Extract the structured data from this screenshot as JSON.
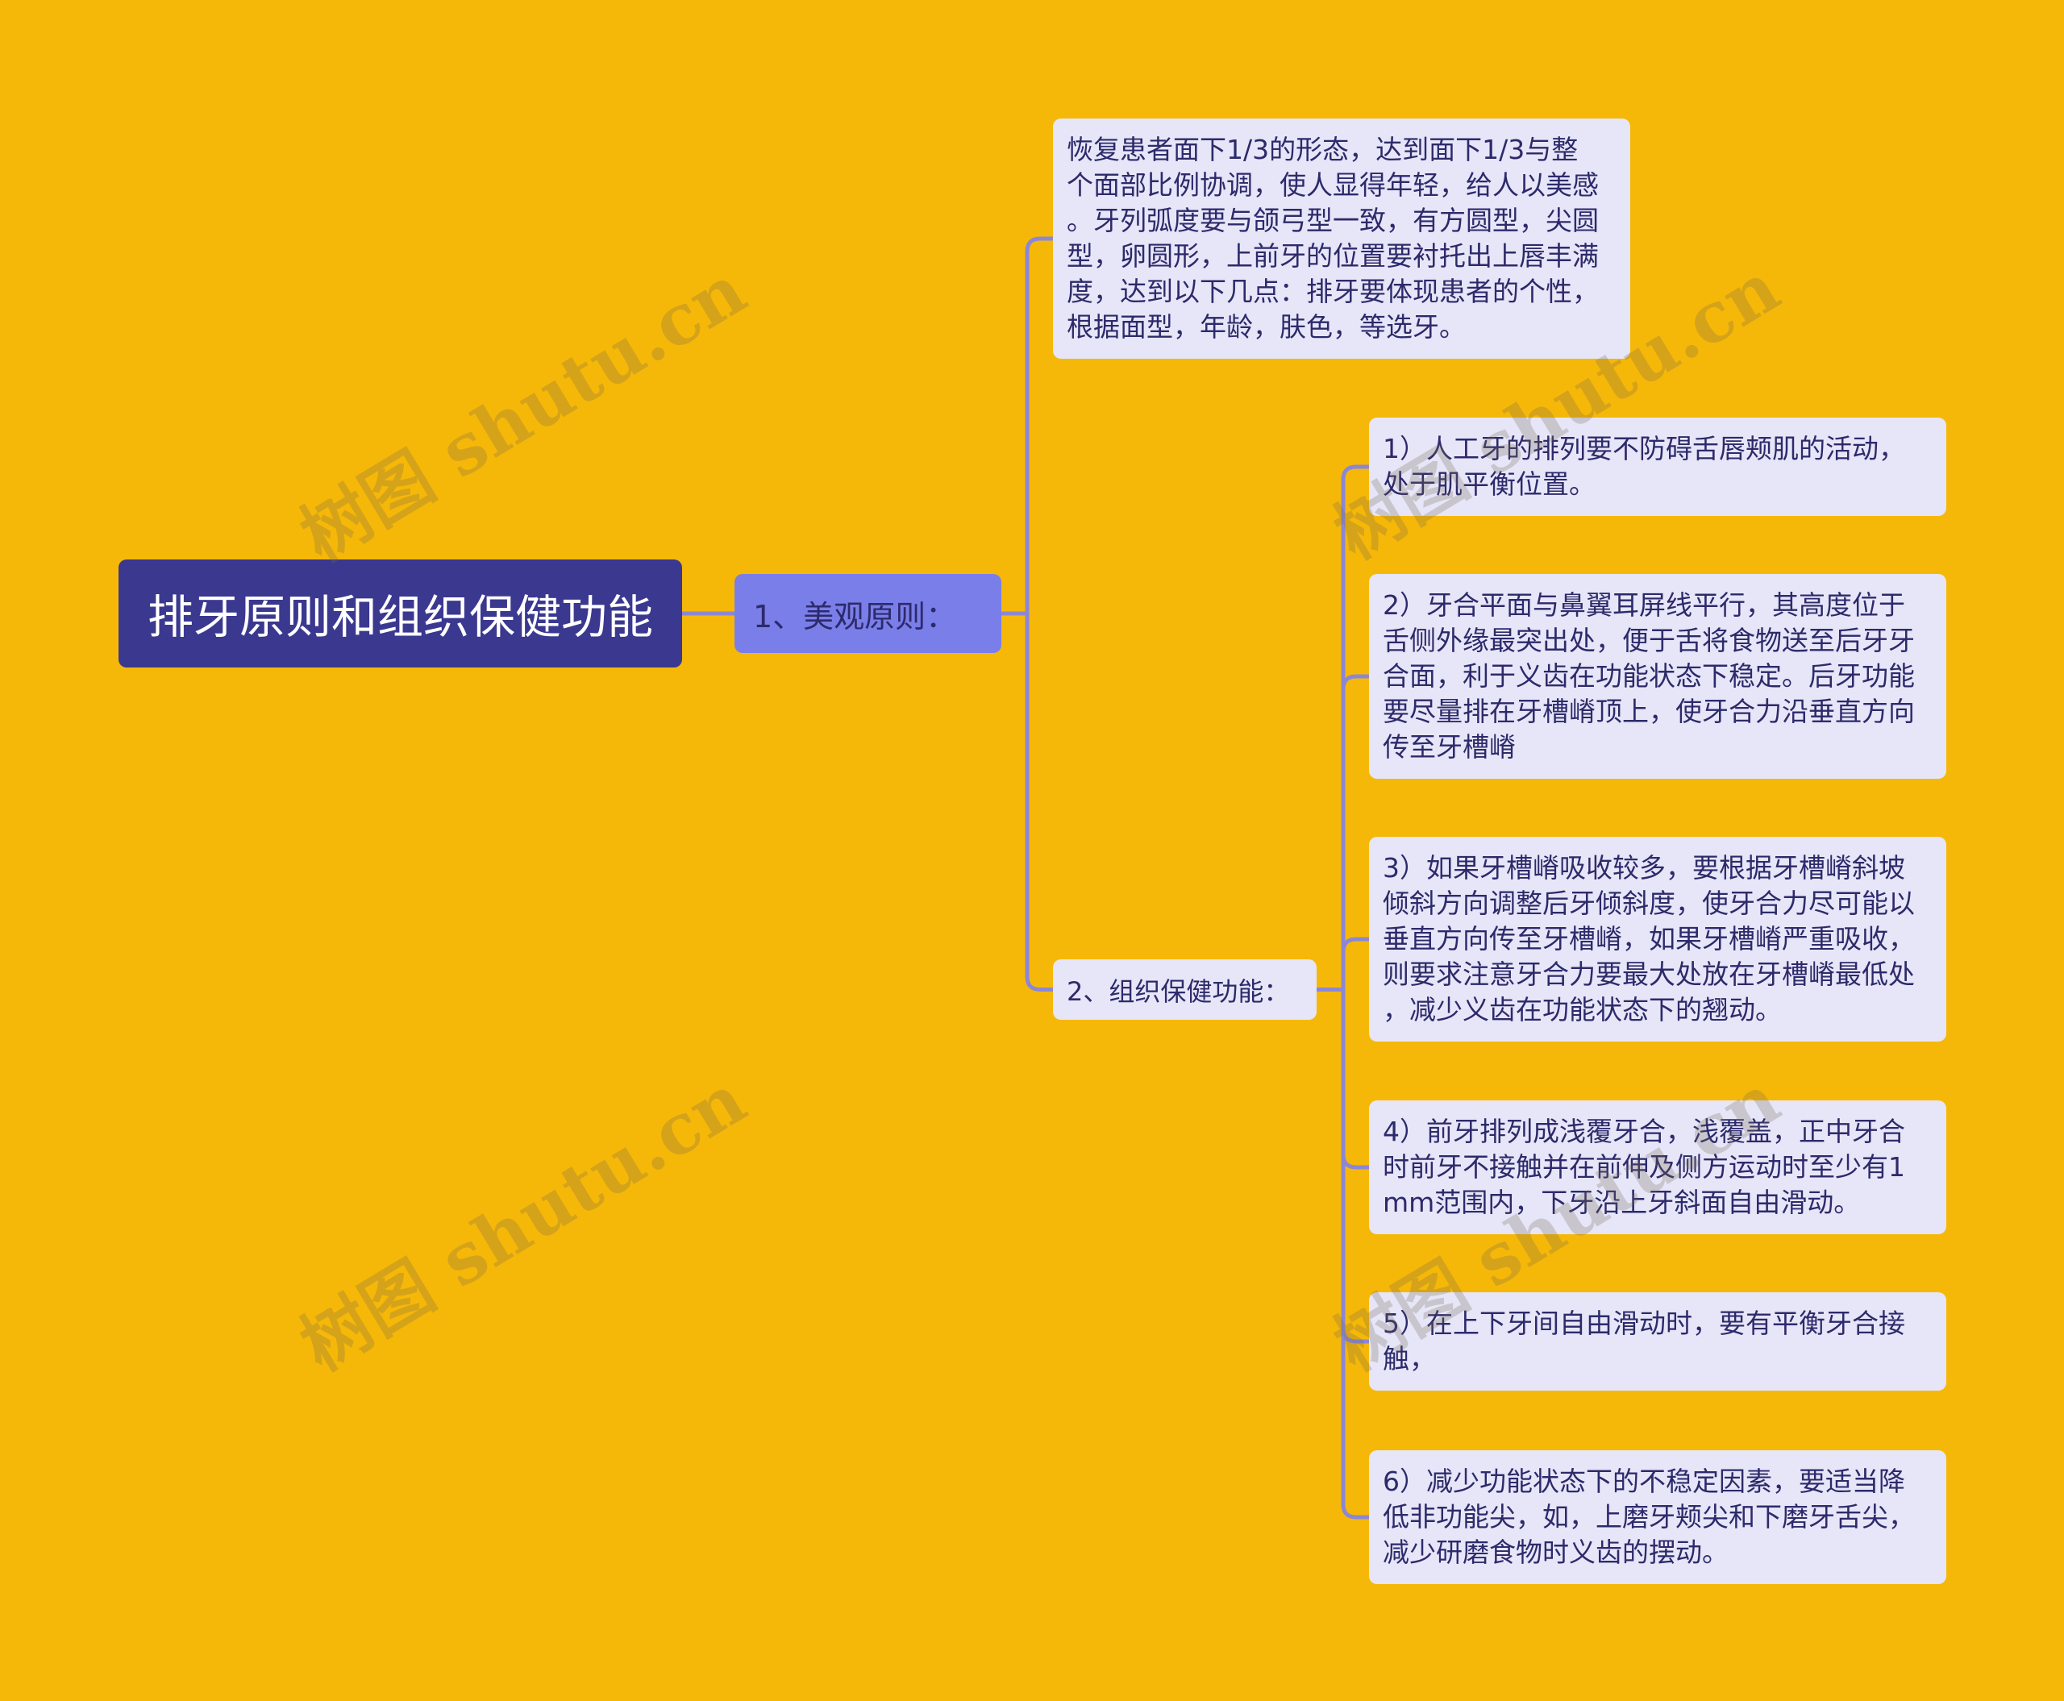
{
  "colors": {
    "background": "#f6b808",
    "root": "#3b3890",
    "branch": "#7a7ee8",
    "leaf": "#e6e6f8",
    "connector": "#8b87d6",
    "text_dark": "#2d2a6b",
    "text_light": "#ffffff"
  },
  "mindmap": {
    "root": {
      "label": "排牙原则和组织保健功能"
    },
    "node1": {
      "label": "1、美观原则：",
      "note": {
        "lines": [
          "恢复患者面下1/3的形态，达到面下1/3与整",
          "个面部比例协调，使人显得年轻，给人以美感",
          "。牙列弧度要与颌弓型一致，有方圆型，尖圆",
          "型，卵圆形，上前牙的位置要衬托出上唇丰满",
          "度，达到以下几点：排牙要体现患者的个性，",
          "根据面型，年龄，肤色，等选牙。"
        ]
      },
      "node2": {
        "label": "2、组织保健功能：",
        "items": [
          {
            "lines": [
              "1）人工牙的排列要不防碍舌唇颊肌的活动，",
              "处于肌平衡位置。"
            ]
          },
          {
            "lines": [
              "2）牙合平面与鼻翼耳屏线平行，其高度位于",
              "舌侧外缘最突出处，便于舌将食物送至后牙牙",
              "合面，利于义齿在功能状态下稳定。后牙功能",
              "要尽量排在牙槽嵴顶上，使牙合力沿垂直方向",
              "传至牙槽嵴"
            ]
          },
          {
            "lines": [
              "3）如果牙槽嵴吸收较多，要根据牙槽嵴斜坡",
              "倾斜方向调整后牙倾斜度，使牙合力尽可能以",
              "垂直方向传至牙槽嵴，如果牙槽嵴严重吸收，",
              "则要求注意牙合力要最大处放在牙槽嵴最低处",
              "，减少义齿在功能状态下的翘动。"
            ]
          },
          {
            "lines": [
              "4）前牙排列成浅覆牙合，浅覆盖，正中牙合",
              "时前牙不接触并在前伸及侧方运动时至少有1",
              "mm范围内，下牙沿上牙斜面自由滑动。"
            ]
          },
          {
            "lines": [
              "5）在上下牙间自由滑动时，要有平衡牙合接",
              "触，"
            ]
          },
          {
            "lines": [
              "6）减少功能状态下的不稳定因素，要适当降",
              "低非功能尖，如，上磨牙颊尖和下磨牙舌尖，",
              "减少研磨食物时义齿的摆动。"
            ]
          }
        ]
      }
    }
  },
  "watermark": {
    "text": "树图 shutu.cn"
  }
}
